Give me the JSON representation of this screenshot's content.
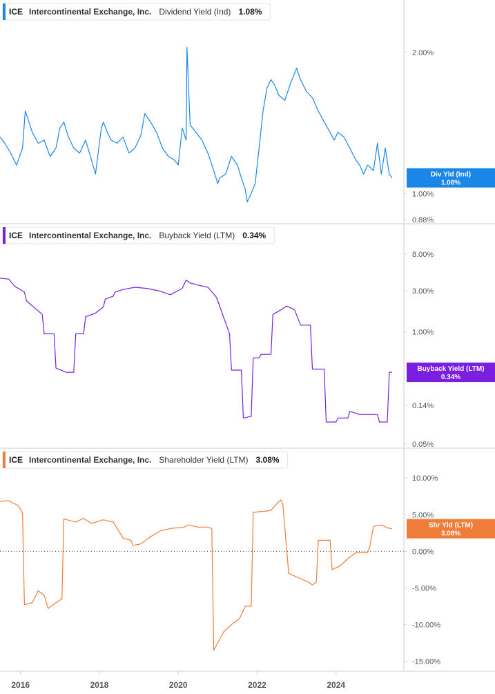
{
  "chart_data": [
    {
      "type": "line",
      "ticker": "ICE",
      "company": "Intercontinental Exchange, Inc.",
      "metric": "Dividend Yield (Ind)",
      "current_value": "1.08%",
      "tag_label": "Div Yld (Ind)",
      "tag_value": "1.08%",
      "color": "#1a86e8",
      "scale": "log",
      "ylim": [
        0.88,
        2.4
      ],
      "y_ticks": [
        {
          "v": 2.0,
          "label": "2.00%"
        },
        {
          "v": 1.0,
          "label": "1.00%"
        },
        {
          "v": 0.88,
          "label": "0.88%"
        }
      ],
      "series": [
        {
          "x": [
            2015.48,
            2015.6,
            2015.75,
            2015.9,
            2016.05,
            2016.12,
            2016.18,
            2016.3,
            2016.45,
            2016.6,
            2016.75,
            2016.9,
            2017.0,
            2017.1,
            2017.2,
            2017.35,
            2017.5,
            2017.65,
            2017.8,
            2017.9,
            2018.05,
            2018.1,
            2018.2,
            2018.3,
            2018.45,
            2018.6,
            2018.75,
            2018.9,
            2019.05,
            2019.15,
            2019.3,
            2019.45,
            2019.6,
            2019.75,
            2019.9,
            2020.0,
            2020.1,
            2020.2,
            2020.22,
            2020.3,
            2020.45,
            2020.6,
            2020.75,
            2020.9,
            2021.0,
            2021.05,
            2021.2,
            2021.35,
            2021.5,
            2021.6,
            2021.7,
            2021.75,
            2021.85,
            2021.95,
            2022.05,
            2022.15,
            2022.25,
            2022.35,
            2022.45,
            2022.55,
            2022.7,
            2022.85,
            2023.0,
            2023.1,
            2023.25,
            2023.4,
            2023.55,
            2023.7,
            2023.85,
            2023.95,
            2024.05,
            2024.2,
            2024.35,
            2024.5,
            2024.6,
            2024.7,
            2024.8,
            2024.95,
            2025.05,
            2025.15,
            2025.25,
            2025.35,
            2025.42
          ],
          "values": [
            1.32,
            1.28,
            1.22,
            1.15,
            1.25,
            1.5,
            1.45,
            1.35,
            1.28,
            1.3,
            1.2,
            1.25,
            1.38,
            1.42,
            1.33,
            1.25,
            1.22,
            1.3,
            1.18,
            1.1,
            1.38,
            1.42,
            1.35,
            1.3,
            1.28,
            1.32,
            1.22,
            1.25,
            1.33,
            1.48,
            1.42,
            1.35,
            1.25,
            1.2,
            1.18,
            1.15,
            1.38,
            1.3,
            2.05,
            1.4,
            1.35,
            1.3,
            1.22,
            1.12,
            1.05,
            1.08,
            1.1,
            1.2,
            1.15,
            1.08,
            1.02,
            0.96,
            1.0,
            1.05,
            1.25,
            1.5,
            1.68,
            1.75,
            1.7,
            1.62,
            1.58,
            1.72,
            1.85,
            1.75,
            1.65,
            1.6,
            1.5,
            1.42,
            1.35,
            1.3,
            1.35,
            1.32,
            1.25,
            1.18,
            1.15,
            1.1,
            1.15,
            1.12,
            1.28,
            1.1,
            1.25,
            1.1,
            1.08
          ]
        }
      ]
    },
    {
      "type": "line",
      "ticker": "ICE",
      "company": "Intercontinental Exchange, Inc.",
      "metric": "Buyback Yield (LTM)",
      "current_value": "0.34%",
      "tag_label": "Buyback Yield (LTM)",
      "tag_value": "0.34%",
      "color": "#7a1ee0",
      "scale": "log",
      "ylim": [
        0.05,
        12.0
      ],
      "y_ticks": [
        {
          "v": 8.0,
          "label": "8.00%"
        },
        {
          "v": 3.0,
          "label": "3.00%"
        },
        {
          "v": 1.0,
          "label": "1.00%"
        },
        {
          "v": 0.14,
          "label": "0.14%"
        },
        {
          "v": 0.05,
          "label": "0.05%"
        }
      ],
      "series": [
        {
          "x": [
            2015.48,
            2015.7,
            2015.85,
            2016.1,
            2016.15,
            2016.3,
            2016.55,
            2016.6,
            2016.85,
            2016.9,
            2017.1,
            2017.15,
            2017.35,
            2017.4,
            2017.6,
            2017.65,
            2017.9,
            2018.1,
            2018.15,
            2018.35,
            2018.4,
            2018.6,
            2018.9,
            2019.2,
            2019.5,
            2019.8,
            2020.1,
            2020.2,
            2020.3,
            2020.5,
            2020.75,
            2020.95,
            2021.0,
            2021.3,
            2021.35,
            2021.6,
            2021.65,
            2021.85,
            2021.9,
            2022.05,
            2022.1,
            2022.35,
            2022.4,
            2022.6,
            2022.75,
            2022.95,
            2023.1,
            2023.15,
            2023.35,
            2023.4,
            2023.7,
            2023.75,
            2024.0,
            2024.05,
            2024.3,
            2024.35,
            2024.6,
            2024.8,
            2025.05,
            2025.1,
            2025.3,
            2025.35,
            2025.42
          ],
          "values": [
            4.2,
            4.1,
            3.4,
            2.9,
            2.3,
            2.0,
            1.6,
            0.95,
            0.95,
            0.38,
            0.35,
            0.34,
            0.34,
            0.95,
            0.95,
            1.5,
            1.65,
            1.95,
            2.4,
            2.6,
            2.9,
            3.1,
            3.3,
            3.2,
            3.0,
            2.7,
            3.2,
            4.0,
            3.7,
            3.5,
            3.3,
            2.6,
            2.3,
            0.95,
            0.36,
            0.36,
            0.1,
            0.105,
            0.5,
            0.5,
            0.55,
            0.55,
            1.6,
            1.8,
            2.0,
            1.8,
            1.2,
            1.2,
            1.2,
            0.37,
            0.37,
            0.09,
            0.09,
            0.1,
            0.1,
            0.12,
            0.11,
            0.11,
            0.11,
            0.09,
            0.09,
            0.34,
            0.34
          ]
        }
      ]
    },
    {
      "type": "line",
      "ticker": "ICE",
      "company": "Intercontinental Exchange, Inc.",
      "metric": "Shareholder Yield (LTM)",
      "current_value": "3.08%",
      "tag_label": "Shr Yld (LTM)",
      "tag_value": "3.08%",
      "color": "#f07d3a",
      "scale": "linear",
      "ylim": [
        -15.8,
        12.0
      ],
      "zero_line": true,
      "y_ticks": [
        {
          "v": 10,
          "label": "10.00%"
        },
        {
          "v": 5,
          "label": "5.00%"
        },
        {
          "v": 0,
          "label": "0.00%"
        },
        {
          "v": -5,
          "label": "-5.00%"
        },
        {
          "v": -10,
          "label": "-10.00%"
        },
        {
          "v": -15,
          "label": "-15.00%"
        }
      ],
      "series": [
        {
          "x": [
            2015.48,
            2015.7,
            2015.95,
            2016.05,
            2016.1,
            2016.3,
            2016.45,
            2016.6,
            2016.7,
            2016.85,
            2017.05,
            2017.1,
            2017.4,
            2017.6,
            2017.8,
            2018.1,
            2018.35,
            2018.6,
            2018.8,
            2018.85,
            2019.05,
            2019.3,
            2019.55,
            2019.8,
            2020.15,
            2020.25,
            2020.5,
            2020.75,
            2020.85,
            2020.9,
            2021.15,
            2021.35,
            2021.55,
            2021.7,
            2021.85,
            2021.9,
            2022.05,
            2022.25,
            2022.35,
            2022.55,
            2022.6,
            2022.65,
            2022.8,
            2023.0,
            2023.3,
            2023.4,
            2023.5,
            2023.55,
            2023.85,
            2023.9,
            2024.1,
            2024.3,
            2024.5,
            2024.8,
            2024.85,
            2024.95,
            2025.15,
            2025.3,
            2025.42
          ],
          "values": [
            6.8,
            6.9,
            6.2,
            5.2,
            -7.3,
            -7.0,
            -5.4,
            -6.0,
            -7.8,
            -7.2,
            -6.5,
            4.4,
            4.0,
            4.5,
            3.8,
            4.3,
            4.0,
            1.8,
            1.5,
            0.8,
            1.0,
            2.0,
            2.8,
            3.1,
            3.3,
            3.6,
            3.3,
            3.3,
            3.1,
            -13.5,
            -11.0,
            -10.0,
            -9.2,
            -7.5,
            -7.5,
            5.3,
            5.4,
            5.5,
            5.6,
            6.8,
            7.0,
            6.5,
            -3.0,
            -3.5,
            -4.2,
            -4.6,
            -4.2,
            1.5,
            1.5,
            -2.5,
            -2.0,
            -1.0,
            -0.2,
            -0.2,
            0.5,
            3.4,
            3.6,
            3.2,
            3.08
          ]
        }
      ]
    }
  ],
  "x_axis": {
    "xlim": [
      2015.48,
      2025.72
    ],
    "ticks": [
      {
        "v": 2016,
        "label": "2016"
      },
      {
        "v": 2018,
        "label": "2018"
      },
      {
        "v": 2020,
        "label": "2020"
      },
      {
        "v": 2022,
        "label": "2022"
      },
      {
        "v": 2024,
        "label": "2024"
      }
    ]
  }
}
